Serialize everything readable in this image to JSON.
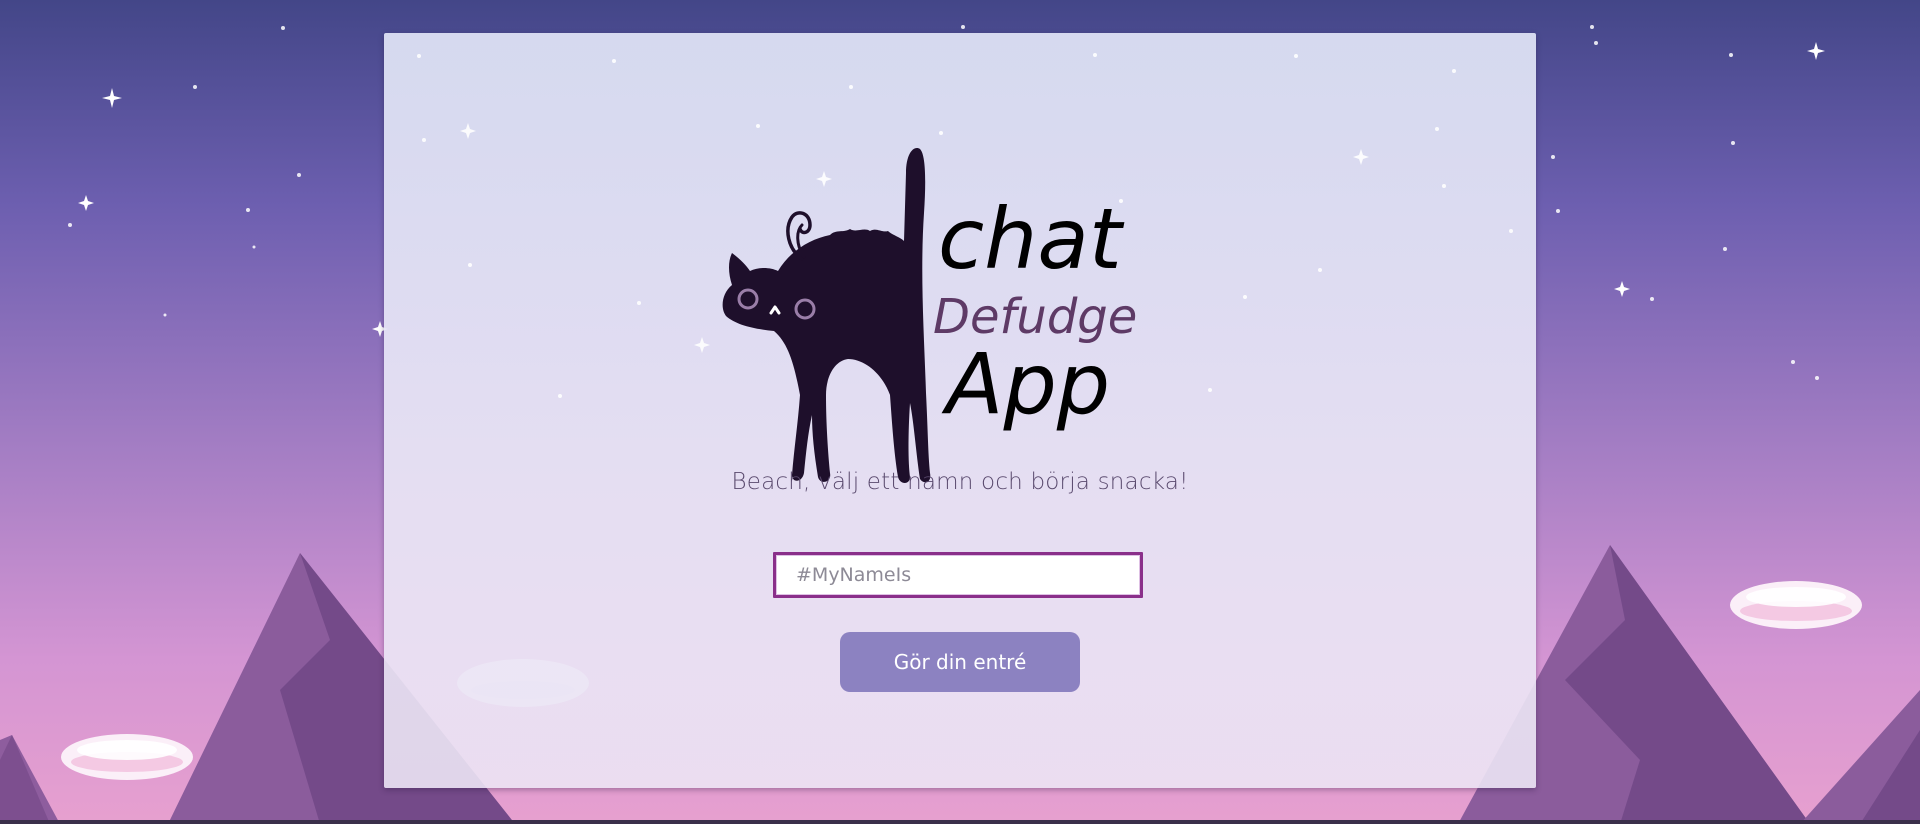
{
  "logo": {
    "line1": "chat",
    "line2": "Defudge",
    "line3": "App"
  },
  "tagline": "Beach, välj ett namn och börja snacka!",
  "form": {
    "name_placeholder": "#MyNameIs",
    "name_value": "",
    "submit_label": "Gör din entré"
  },
  "colors": {
    "sky_top": "#444889",
    "sky_bottom": "#e49ed0",
    "mountain": "#8a5c9a",
    "cat": "#1e0f2b",
    "defudge_text": "#5e3a66",
    "button": "#8c82c1",
    "input_border": "#8a2f8a"
  },
  "icons": [
    "cat-logo-icon",
    "star-icon",
    "cloud-icon",
    "mountain-icon"
  ]
}
